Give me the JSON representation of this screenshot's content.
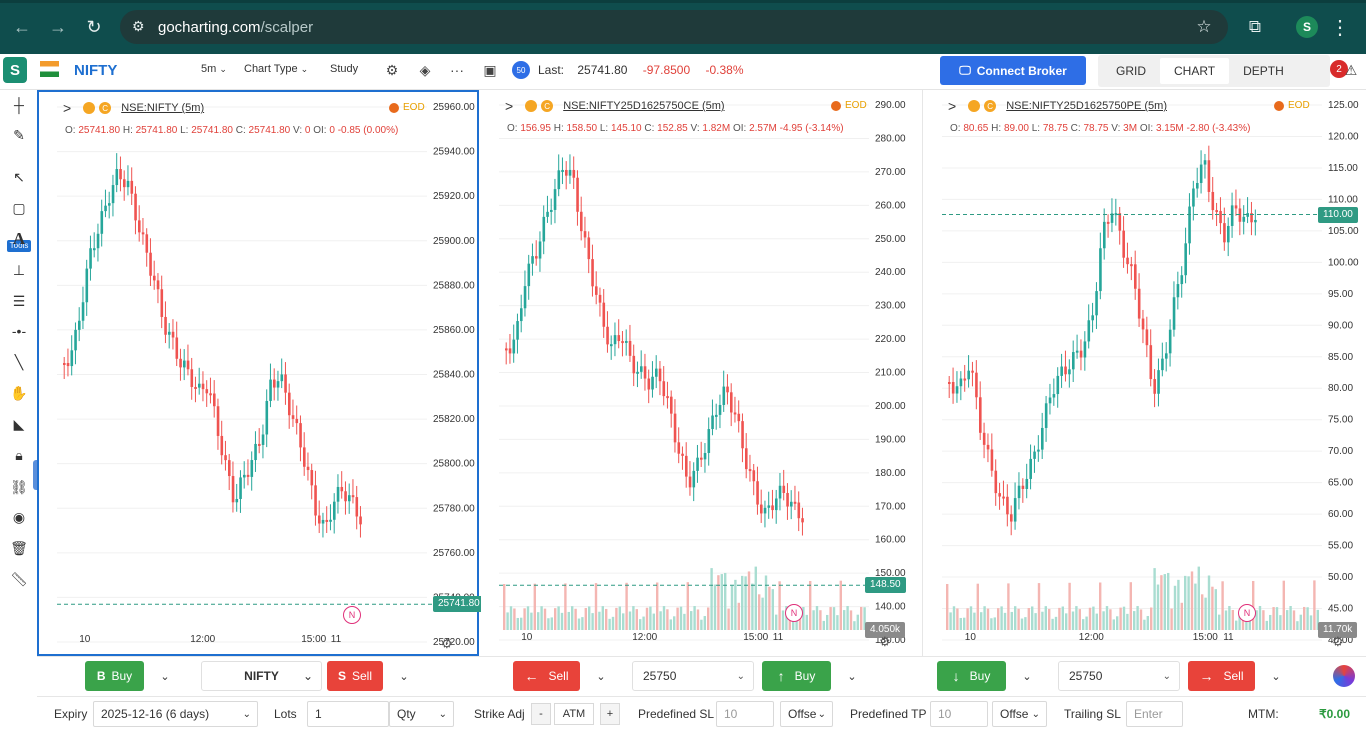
{
  "browser": {
    "url_domain": "gocharting.com",
    "url_path": "/scalper",
    "profile_initial": "S"
  },
  "app": {
    "logo": "S",
    "symbol": "NIFTY",
    "interval": "5m",
    "chart_type": "Chart Type",
    "study": "Study",
    "last_label": "Last:",
    "last_value": "25741.80",
    "change": "-97.8500",
    "change_pct": "-0.38%",
    "connect_broker": "Connect Broker",
    "views": [
      "GRID",
      "CHART",
      "DEPTH"
    ],
    "active_view": "CHART",
    "notifications": "2",
    "tools_label": "Tools",
    "icons": [
      "crosshair-icon",
      "pencil-icon",
      "cursor-icon",
      "rectangle-icon",
      "text-icon",
      "measure-icon",
      "fib-icon",
      "dot-line-icon",
      "trend-line-icon",
      "hand-icon",
      "ruler-icon",
      "lock-icon",
      "link-icon",
      "eye-icon",
      "trash-icon",
      "scale-icon"
    ]
  },
  "panels": [
    {
      "ticker": "NSE:NIFTY (5m)",
      "eod": "EOD",
      "o": "25741.80",
      "h": "25741.80",
      "l": "25741.80",
      "c": "25741.80",
      "v": "0",
      "oi": "0",
      "chg": "-0.85",
      "chg_pct": "(0.00%)",
      "price_label": "25741.80",
      "y_ticks": [
        "25960.00",
        "25940.00",
        "25920.00",
        "25900.00",
        "25880.00",
        "25860.00",
        "25840.00",
        "25820.00",
        "25800.00",
        "25780.00",
        "25760.00",
        "25740.00",
        "25720.00"
      ],
      "x_ticks": [
        "10",
        "12:00",
        "15:00",
        "11"
      ],
      "badge": "N"
    },
    {
      "ticker": "NSE:NIFTY25D1625750CE (5m)",
      "eod": "EOD",
      "o": "156.95",
      "h": "158.50",
      "l": "145.10",
      "c": "152.85",
      "v": "1.82M",
      "oi": "2.57M",
      "chg": "-4.95",
      "chg_pct": "(-3.14%)",
      "price_label": "148.50",
      "vol_label": "4.050k",
      "y_ticks": [
        "290.00",
        "280.00",
        "270.00",
        "260.00",
        "250.00",
        "240.00",
        "230.00",
        "220.00",
        "210.00",
        "200.00",
        "190.00",
        "180.00",
        "170.00",
        "160.00",
        "150.00",
        "140.00",
        "130.00"
      ],
      "x_ticks": [
        "10",
        "12:00",
        "15:00",
        "11"
      ],
      "badge": "N"
    },
    {
      "ticker": "NSE:NIFTY25D1625750PE (5m)",
      "eod": "EOD",
      "o": "80.65",
      "h": "89.00",
      "l": "78.75",
      "c": "78.75",
      "v": "3M",
      "oi": "3.15M",
      "chg": "-2.80",
      "chg_pct": "(-3.43%)",
      "price_label": "110.00",
      "vol_label": "11.70k",
      "y_ticks": [
        "125.00",
        "120.00",
        "115.00",
        "110.00",
        "105.00",
        "100.00",
        "95.00",
        "90.00",
        "85.00",
        "80.00",
        "75.00",
        "70.00",
        "65.00",
        "60.00",
        "55.00",
        "50.00",
        "45.00",
        "40.00"
      ],
      "x_ticks": [
        "10",
        "12:00",
        "15:00",
        "11"
      ],
      "badge": "N"
    }
  ],
  "order_bar": {
    "buy": "Buy",
    "sell": "Sell",
    "buy_prefix": "B",
    "sell_prefix": "S",
    "symbol": "NIFTY",
    "ce_sell": "Sell",
    "ce_strike": "25750",
    "ce_buy": "Buy",
    "pe_buy": "Buy",
    "pe_strike": "25750",
    "pe_sell": "Sell"
  },
  "bottom_bar": {
    "expiry_label": "Expiry",
    "expiry_value": "2025-12-16 (6 days)",
    "lots_label": "Lots",
    "lots_value": "1",
    "qty": "Qty",
    "strike_adj": "Strike Adj",
    "minus": "-",
    "atm": "ATM",
    "plus": "+",
    "sl_label": "Predefined SL",
    "sl_placeholder": "10",
    "sl_unit": "Offse",
    "tp_label": "Predefined TP",
    "tp_placeholder": "10",
    "tp_unit": "Offse",
    "trail_label": "Trailing SL",
    "trail_placeholder": "Enter",
    "mtm_label": "MTM:",
    "mtm_value": "₹0.00"
  }
}
